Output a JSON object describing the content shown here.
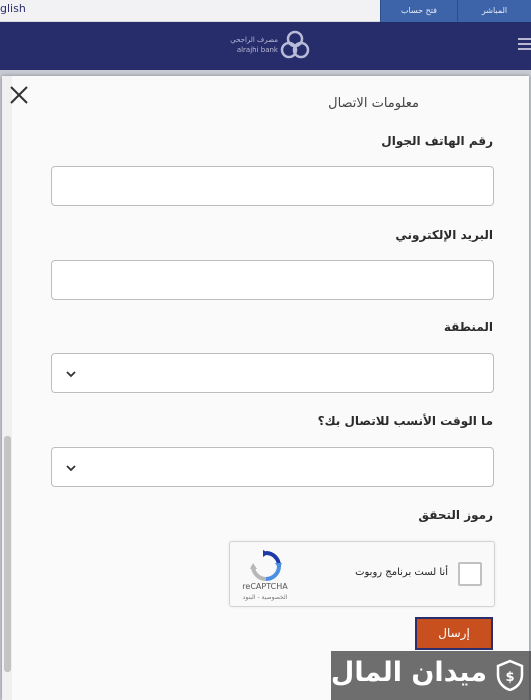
{
  "background": {
    "topbar": {
      "language_link": "glish",
      "tabs": [
        "فتح حساب",
        "المباشر"
      ]
    },
    "navbar": {
      "logo": {
        "name_ar": "مصرف الراجحي",
        "name_en": "alrajhi bank",
        "icon": "alrajhi-logo-icon"
      },
      "menu_icon": "hamburger-icon",
      "color": "#272c6a"
    }
  },
  "modal": {
    "close_icon": "close-icon",
    "section_title": "معلومات الاتصال",
    "fields": {
      "mobile": {
        "label": "رقم الهاتف الجوال",
        "value": "",
        "placeholder": ""
      },
      "email": {
        "label": "البريد الإلكتروني",
        "value": "",
        "placeholder": ""
      },
      "region": {
        "label": "المنطقة",
        "value": "",
        "icon": "chevron-down-icon"
      },
      "best_time": {
        "label": "ما الوقت الأنسب للاتصال بك؟",
        "value": "",
        "icon": "chevron-down-icon"
      }
    },
    "captcha": {
      "label": "رموز التحقق",
      "checkbox_text": "أنا لست برنامج روبوت",
      "brand": "reCAPTCHA",
      "terms": "الخصوصية - البنود",
      "checked": false
    },
    "submit_label": "إرسال",
    "accent_color": "#c8501e"
  },
  "watermark": {
    "text": "ميدان المال"
  }
}
